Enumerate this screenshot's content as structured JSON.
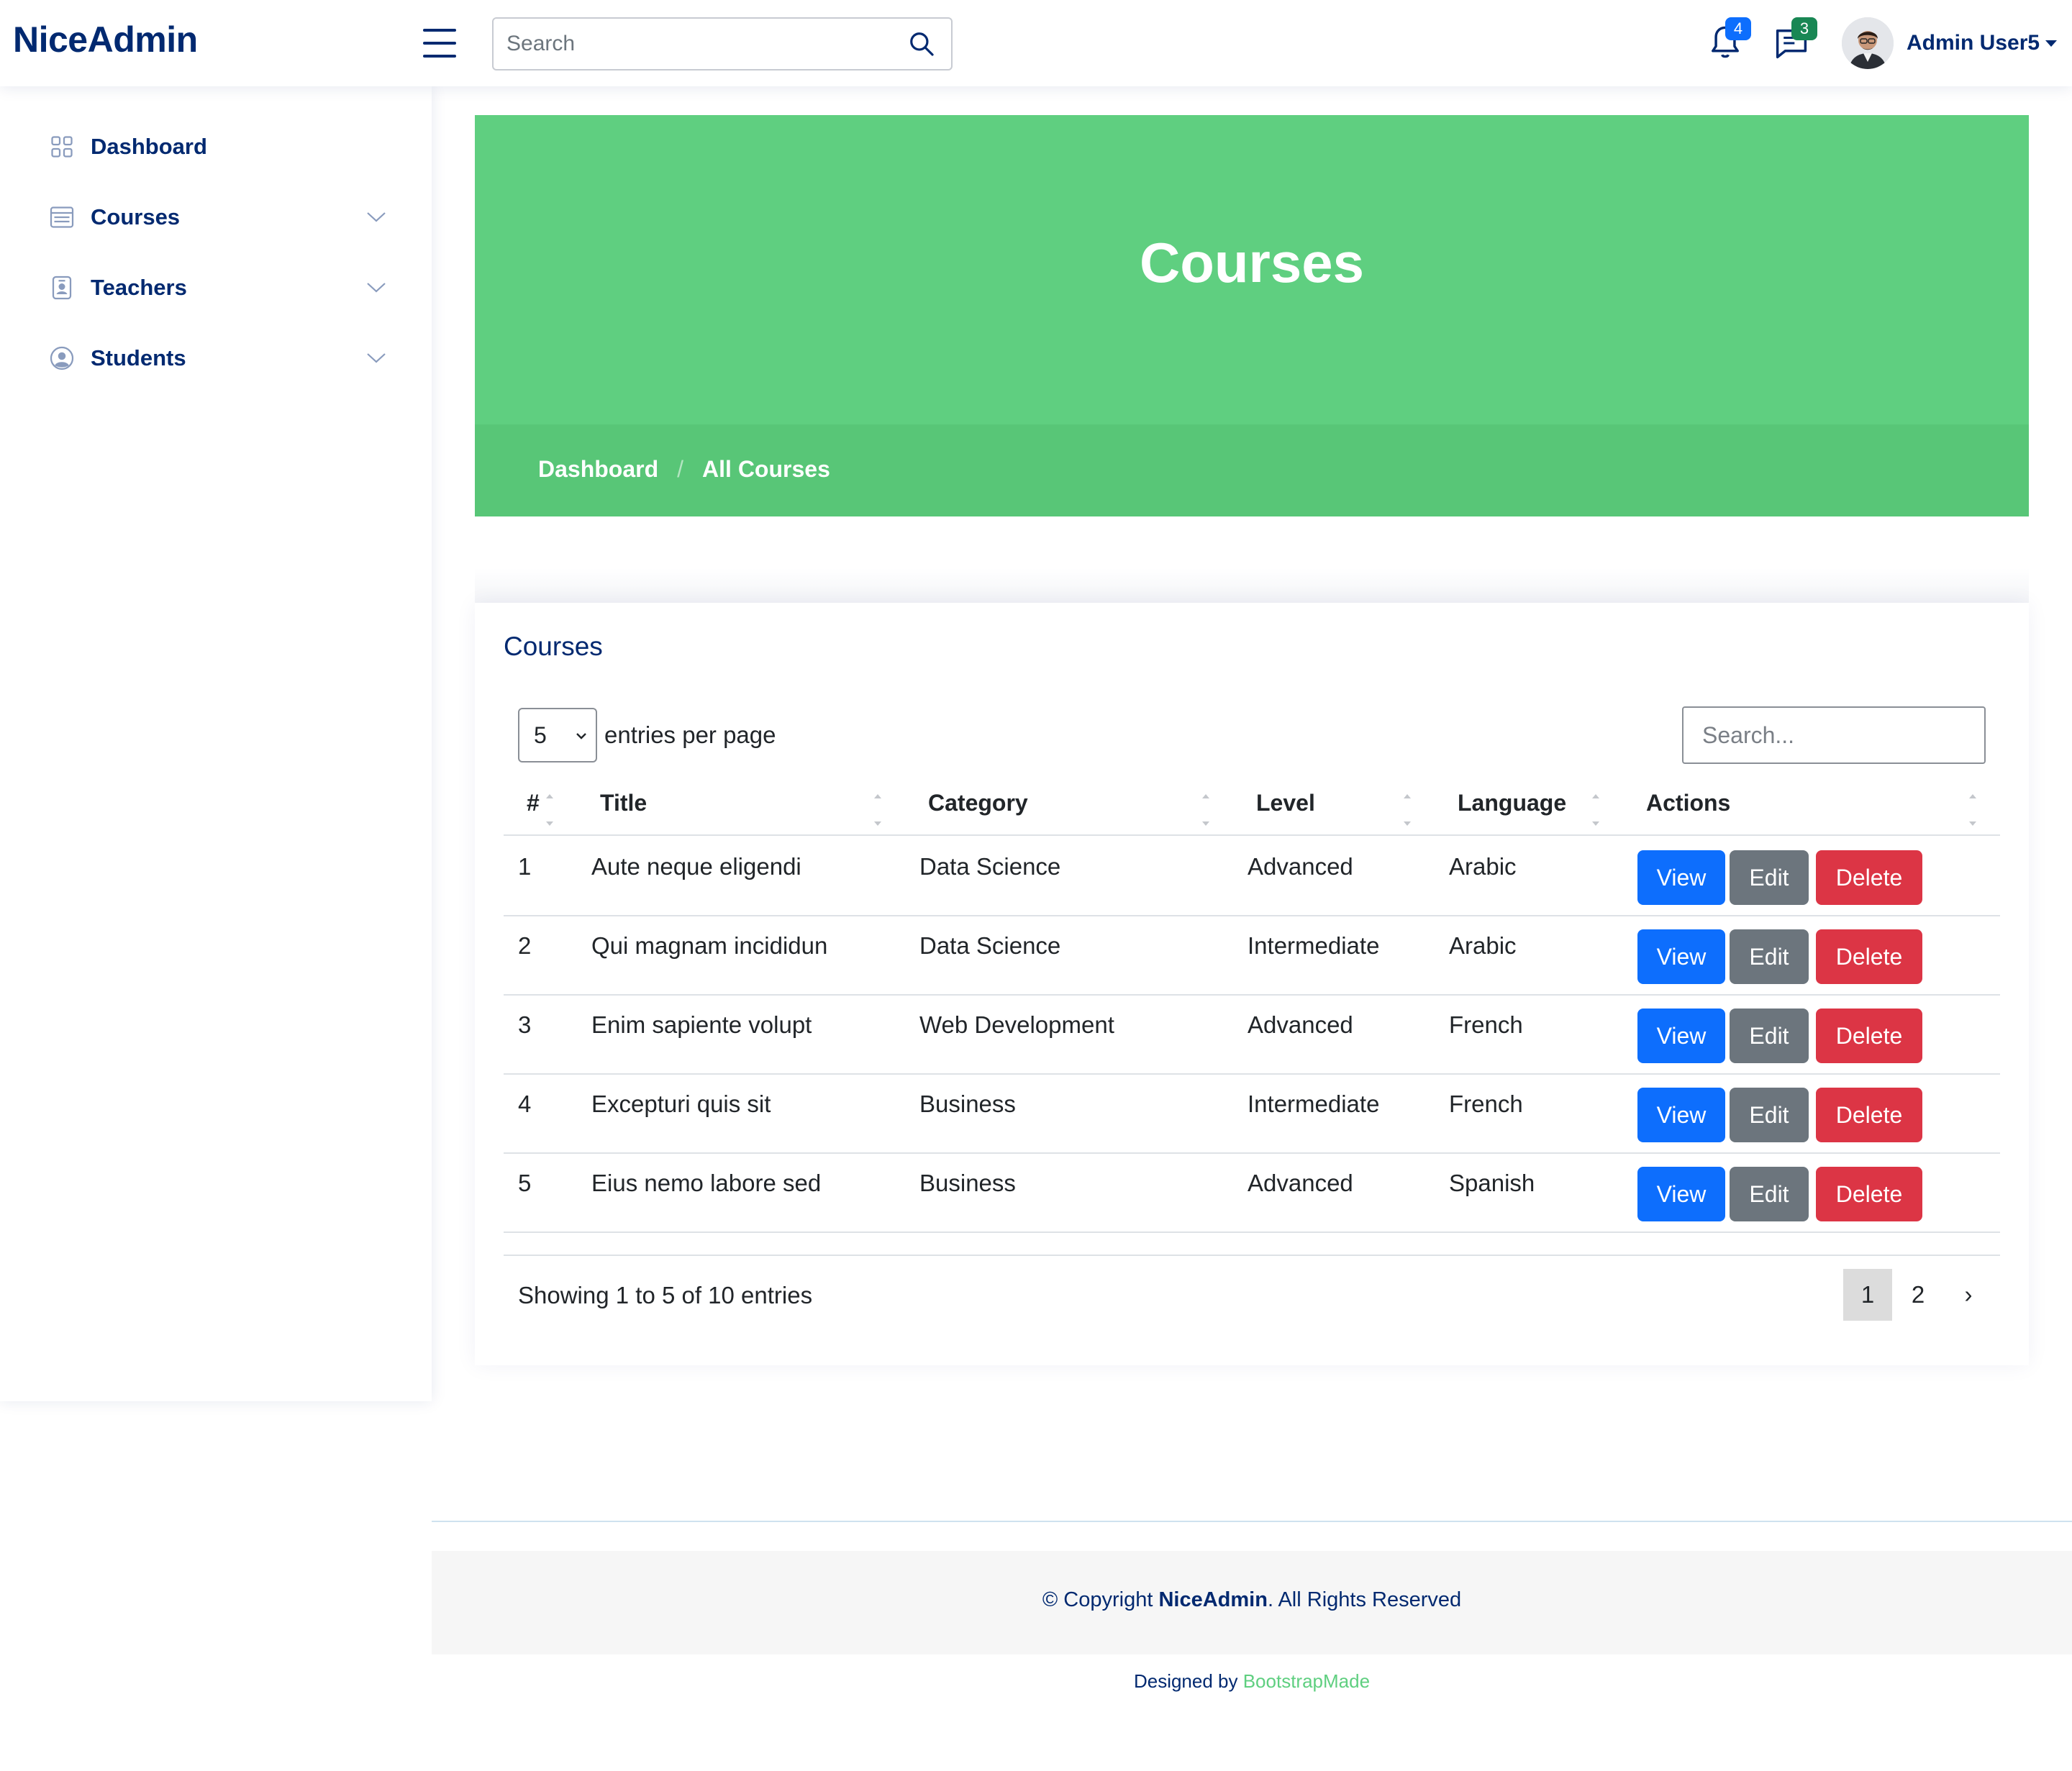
{
  "header": {
    "logo": "NiceAdmin",
    "search_placeholder": "Search",
    "notifications_count": "4",
    "messages_count": "3",
    "user_name": "Admin User5"
  },
  "sidebar": {
    "items": [
      {
        "label": "Dashboard",
        "icon": "grid-icon"
      },
      {
        "label": "Courses",
        "icon": "layout-text-icon"
      },
      {
        "label": "Teachers",
        "icon": "person-badge-icon"
      },
      {
        "label": "Students",
        "icon": "person-circle-icon"
      }
    ]
  },
  "banner": {
    "title": "Courses",
    "breadcrumb": [
      "Dashboard",
      "All Courses"
    ],
    "separator": "/"
  },
  "card": {
    "title": "Courses",
    "entries_value": "5",
    "entries_label": "entries per page",
    "search_placeholder": "Search...",
    "columns": [
      "#",
      "Title",
      "Category",
      "Level",
      "Language",
      "Actions"
    ],
    "rows": [
      {
        "num": "1",
        "title": "Aute neque eligendi",
        "category": "Data Science",
        "level": "Advanced",
        "language": "Arabic"
      },
      {
        "num": "2",
        "title": "Qui magnam incididun",
        "category": "Data Science",
        "level": "Intermediate",
        "language": "Arabic"
      },
      {
        "num": "3",
        "title": "Enim sapiente volupt",
        "category": "Web Development",
        "level": "Advanced",
        "language": "French"
      },
      {
        "num": "4",
        "title": "Excepturi quis sit",
        "category": "Business",
        "level": "Intermediate",
        "language": "French"
      },
      {
        "num": "5",
        "title": "Eius nemo labore sed",
        "category": "Business",
        "level": "Advanced",
        "language": "Spanish"
      }
    ],
    "actions": {
      "view": "View",
      "edit": "Edit",
      "delete": "Delete"
    },
    "showing": "Showing 1 to 5 of 10 entries",
    "pages": [
      "1",
      "2",
      "›"
    ]
  },
  "footer": {
    "copyright_prefix": "© Copyright ",
    "copyright_brand": "NiceAdmin",
    "copyright_suffix": ". All Rights Reserved",
    "designed_by": "Designed by ",
    "designer": "BootstrapMade"
  },
  "colors": {
    "brand": "#012970",
    "banner": "#5fcf80",
    "view": "#0d6efd",
    "edit": "#6c757d",
    "delete": "#dc3545"
  }
}
